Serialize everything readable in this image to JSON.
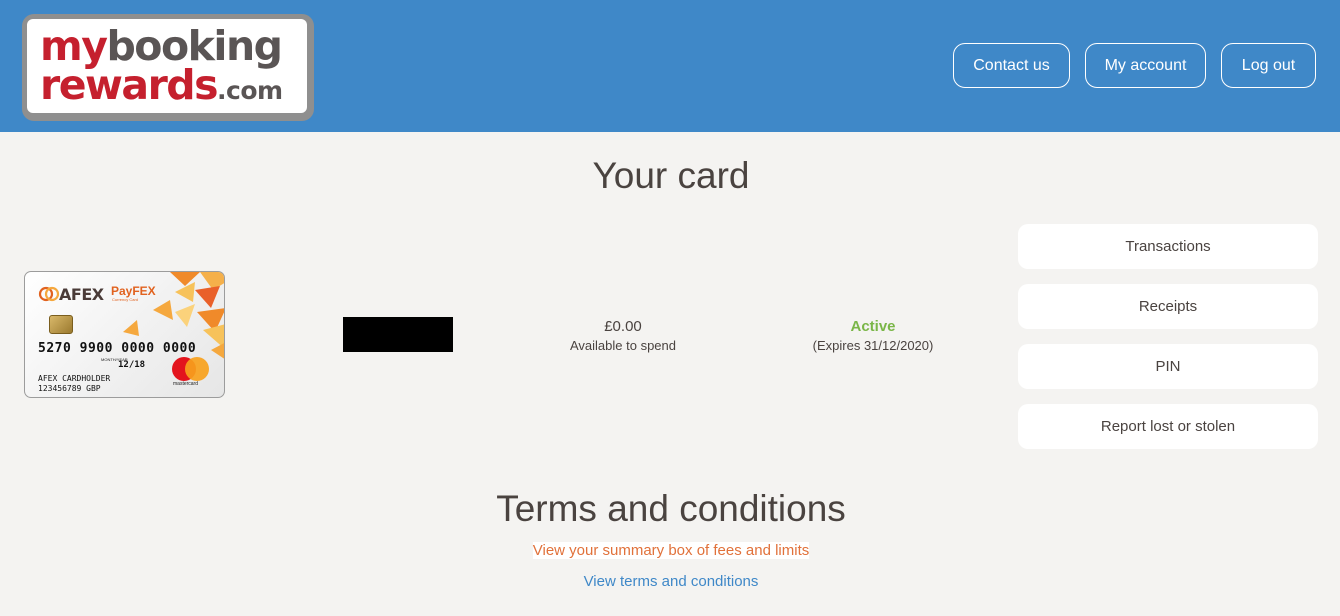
{
  "header": {
    "logo": {
      "line1_a": "my",
      "line1_b": "booking",
      "line2_a": "rewards",
      "line2_b": ".com"
    },
    "nav": {
      "contact": "Contact us",
      "account": "My account",
      "logout": "Log out"
    },
    "colors": {
      "header_bg": "#3f88c8",
      "brand_red": "#c5202e"
    }
  },
  "page": {
    "title": "Your card"
  },
  "card": {
    "brand": "AFEX",
    "product": "PayFEX",
    "product_sub": "Currency Card",
    "number": "5270 9900 0000 0000",
    "valid_label": "MONTH/YEAR",
    "valid_prefix": "EXPIRES END",
    "expiry": "12/18",
    "holder": "AFEX CARDHOLDER",
    "account": "123456789 GBP",
    "network": "mastercard"
  },
  "balance": {
    "amount": "£0.00",
    "label": "Available to spend"
  },
  "status": {
    "text": "Active",
    "expiry": "(Expires 31/12/2020)",
    "color": "#7ab648"
  },
  "actions": [
    "Transactions",
    "Receipts",
    "PIN",
    "Report lost or stolen"
  ],
  "terms": {
    "title": "Terms and conditions",
    "summary_link": "View your summary box of fees and limits",
    "terms_link": "View terms and conditions"
  }
}
